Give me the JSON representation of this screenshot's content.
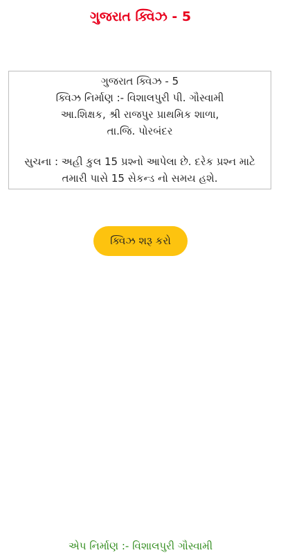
{
  "header": {
    "title": "ગુજરાત ક્વિઝ - 5"
  },
  "info": {
    "line1": "ગુજરાત ક્વિઝ - 5",
    "line2": "ક્વિઝ નિર્માણ :- વિશાલપુરી પી. ગૌસ્વામી",
    "line3": "આ.શિક્ષક, શ્રી રાજપુર પ્રાથમિક શાળા,",
    "line4": "તા.જિ. પોરબંદર",
    "notice1": "સુચના : અહી કુલ 15 પ્રશ્નો આપેલા છે. દરેક પ્રશ્ન માટે",
    "notice2": "તમારી પાસે 15 સેકન્ડ નો સમય હશે."
  },
  "actions": {
    "start_label": "ક્વિઝ શરૂ કરો"
  },
  "footer": {
    "credit": "એપ નિર્માણ :- વિશાલપુરી ગૌસ્વામી"
  },
  "colors": {
    "title": "#e8001c",
    "button": "#fdc30f",
    "footer": "#2e8b1a",
    "box_border": "#bdbdbd"
  }
}
